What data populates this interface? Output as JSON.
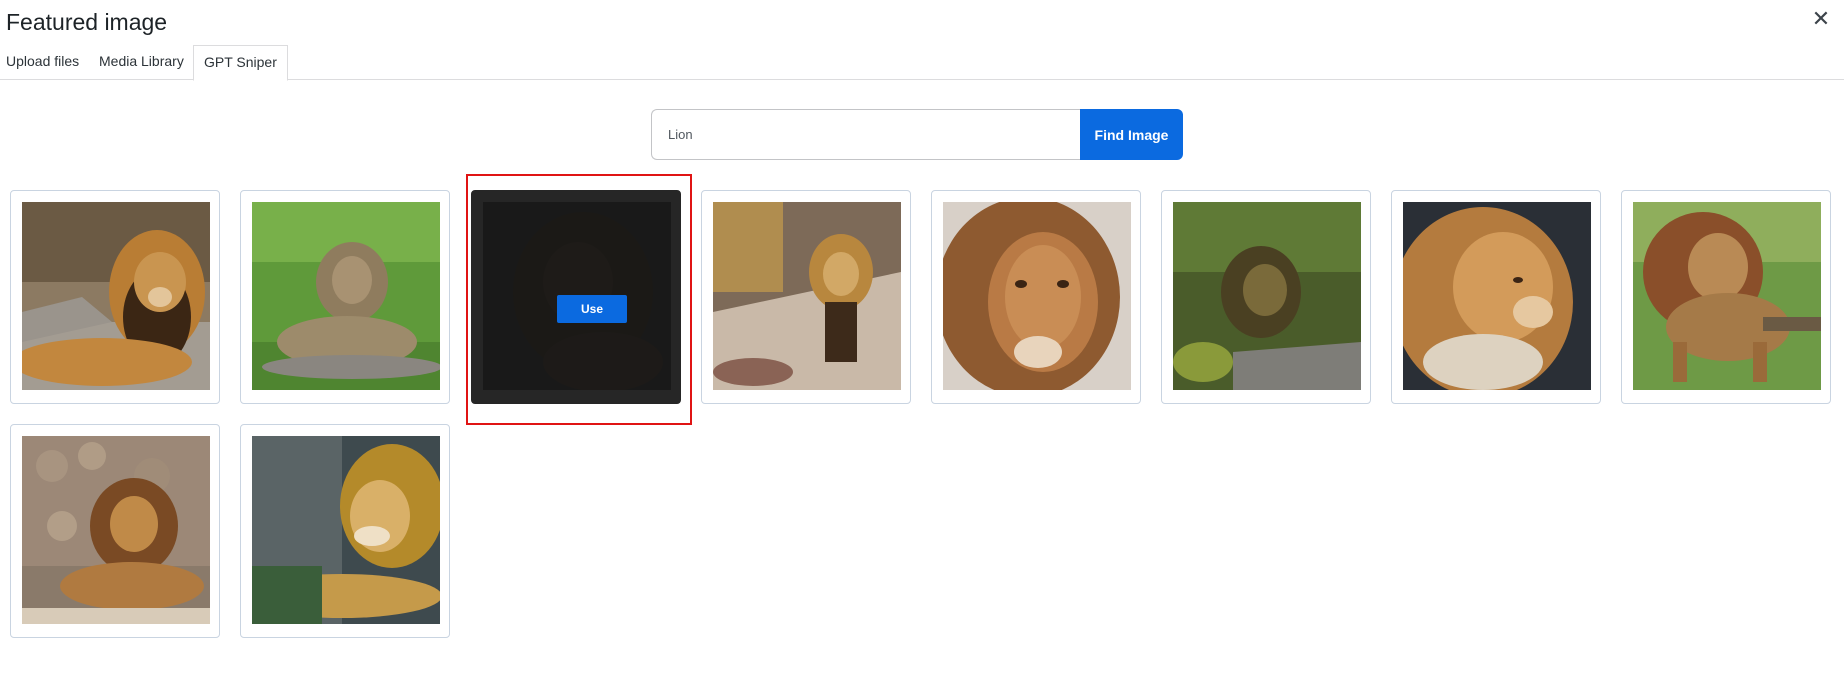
{
  "modal": {
    "title": "Featured image",
    "close_icon": "close-icon"
  },
  "tabs": [
    {
      "label": "Upload files",
      "active": false
    },
    {
      "label": "Media Library",
      "active": false
    },
    {
      "label": "GPT Sniper",
      "active": true
    }
  ],
  "search": {
    "value": "Lion",
    "button_label": "Find Image"
  },
  "results": {
    "use_label": "Use",
    "selected_index": 2,
    "items": [
      {
        "subject": "lion-lying-on-rock"
      },
      {
        "subject": "lion-lying-in-grass"
      },
      {
        "subject": "lion-portrait-dark"
      },
      {
        "subject": "lion-standing-on-path"
      },
      {
        "subject": "lion-face-closeup"
      },
      {
        "subject": "lion-sitting-in-shade"
      },
      {
        "subject": "lion-profile-closeup"
      },
      {
        "subject": "lion-standing-in-grass"
      },
      {
        "subject": "lion-sitting-by-stone-wall"
      },
      {
        "subject": "lion-resting-by-rock"
      }
    ]
  },
  "colors": {
    "accent": "#0b6ae0",
    "highlight": "#e01414",
    "card_border": "#c9d4e1"
  }
}
